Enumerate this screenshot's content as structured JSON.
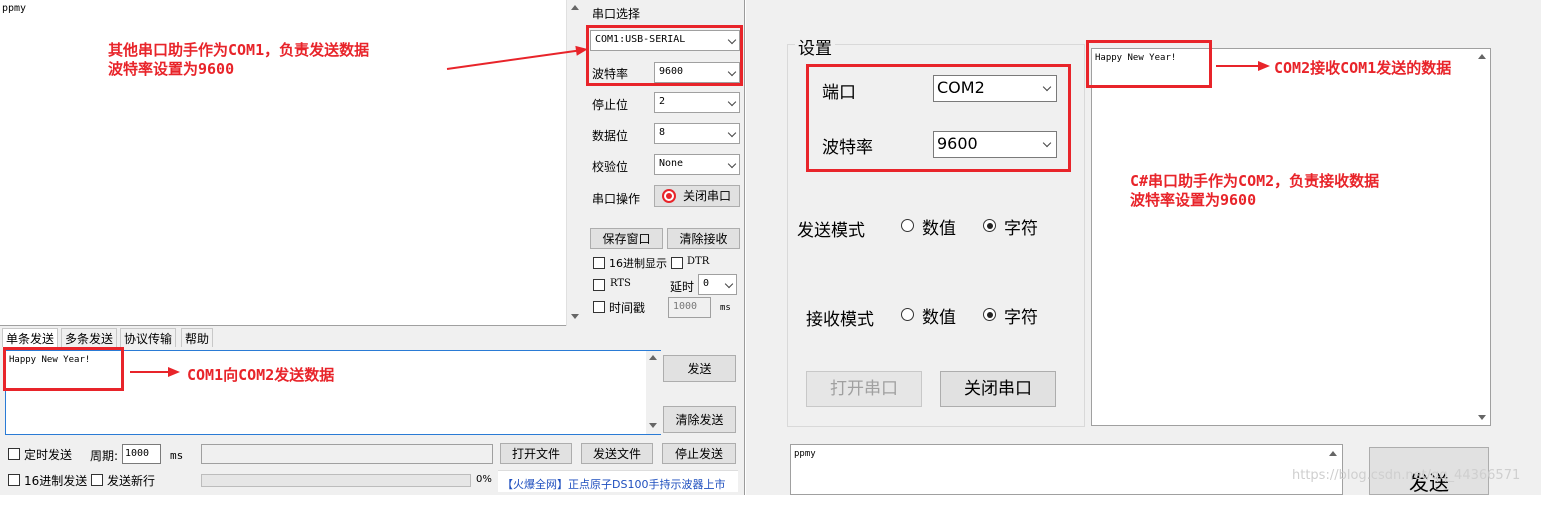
{
  "left_app": {
    "receive_text": "ppmy",
    "serial_select_title": "串口选择",
    "port_value": "COM1:USB-SERIAL",
    "baud_label": "波特率",
    "baud_value": "9600",
    "stopbits_label": "停止位",
    "stopbits_value": "2",
    "databits_label": "数据位",
    "databits_value": "8",
    "parity_label": "校验位",
    "parity_value": "None",
    "serial_op_label": "串口操作",
    "close_port_button": "关闭串口",
    "save_window_button": "保存窗口",
    "clear_receive_button": "清除接收",
    "hex_display_label": "16进制显示",
    "dtr_label": "DTR",
    "rts_label": "RTS",
    "delay_label": "延时",
    "delay_value": "0",
    "timestamp_label": "时间戳",
    "timestamp_value": "1000",
    "timestamp_unit": "ms",
    "tabs": [
      "单条发送",
      "多条发送",
      "协议传输",
      "帮助"
    ],
    "send_text": "Happy New Year!",
    "send_button": "发送",
    "clear_send_button": "清除发送",
    "timed_send_label": "定时发送",
    "period_label": "周期:",
    "period_value": "1000",
    "period_unit": "ms",
    "open_file_button": "打开文件",
    "send_file_button": "发送文件",
    "stop_send_button": "停止发送",
    "hex_send_label": "16进制发送",
    "send_newline_label": "发送新行",
    "progress_text": "0%",
    "ad_link": "【火爆全网】正点原子DS100手持示波器上市"
  },
  "right_app": {
    "settings_group_title": "设置",
    "port_label": "端口",
    "port_value": "COM2",
    "baud_label": "波特率",
    "baud_value": "9600",
    "send_mode_label": "发送模式",
    "receive_mode_label": "接收模式",
    "radio_numeric": "数值",
    "radio_char": "字符",
    "open_port_button": "打开串口",
    "close_port_button": "关闭串口",
    "receive_text": "Happy New Year!",
    "send_input_text": "ppmy",
    "send_button": "发送",
    "watermark": "https://blog.csdn.net/qq_44366571"
  },
  "annotations": {
    "com1_note_line1": "其他串口助手作为COM1，负责发送数据",
    "com1_note_line2": "波特率设置为9600",
    "com1_send_note": "COM1向COM2发送数据",
    "com2_receive_note": "COM2接收COM1发送的数据",
    "com2_note_line1": "C#串口助手作为COM2，负责接收数据",
    "com2_note_line2": "波特率设置为9600",
    "accent_color": "#e8242a"
  }
}
